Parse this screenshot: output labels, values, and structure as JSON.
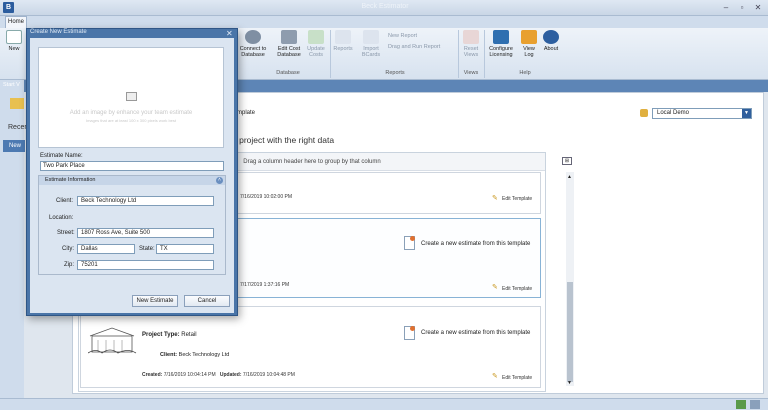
{
  "window": {
    "title": "Beck Estimator"
  },
  "ribbon": {
    "tabs": [
      "Home"
    ],
    "buttons": {
      "new": "New",
      "connect": "Connect to Database",
      "edit_cost": "Edit Cost Database",
      "update_costs": "Update Costs",
      "reports": "Reports",
      "import_bcards": "Import BCards",
      "new_report": "New Report",
      "drag_report": "Drag and Run Report",
      "reset_views": "Reset Views",
      "configure": "Configure Licensing",
      "view_log": "View Log",
      "about": "About"
    },
    "groups": {
      "database": "Database",
      "reports": "Reports",
      "views": "Views",
      "help": "Help"
    }
  },
  "left": {
    "start": "Start V",
    "recent": "Recen",
    "new": "New"
  },
  "main": {
    "template_label": "template",
    "section_title": "e project with the right data",
    "database": "Local Demo",
    "group_header": "Drag a column header here to group by that column"
  },
  "cards": [
    {
      "created": "7/16/2019 10:02:00 PM",
      "edit": "Edit Template"
    },
    {
      "created": "7/17/2019 1:37:16 PM",
      "edit": "Edit Template",
      "new_from": "Create a new estimate from this template"
    },
    {
      "project_type_label": "Project Type:",
      "project_type": "Retail",
      "client_label": "Client:",
      "client": "Beck Technology Ltd",
      "created_label": "Created:",
      "created": "7/16/2019 10:04:14 PM",
      "updated_label": "Updated:",
      "updated": "7/16/2019 10:04:48 PM",
      "edit": "Edit Template",
      "new_from": "Create a new estimate from this template"
    }
  ],
  "dialog": {
    "title": "Create New Estimate",
    "image_placeholder": "Add an image by enhance your team estimate",
    "image_sub": "Images that are at least 100 x 300 pixels work best",
    "name_label": "Estimate Name:",
    "name_value": "Two Park Place",
    "info_header": "Estimate Information",
    "client_label": "Client:",
    "client_value": "Beck Technology Ltd",
    "location_label": "Location:",
    "street_label": "Street:",
    "street_value": "1807 Ross Ave, Suite 500",
    "city_label": "City:",
    "city_value": "Dallas",
    "state_label": "State:",
    "state_value": "TX",
    "zip_label": "Zip:",
    "zip_value": "75201",
    "ok_label": "New Estimate",
    "cancel_label": "Cancel"
  },
  "icons": [
    "app-icon",
    "new-icon",
    "database-icon",
    "cost-db-icon",
    "update-icon",
    "reports-icon",
    "import-icon",
    "reset-views-icon",
    "licensing-icon",
    "log-icon",
    "about-icon",
    "image-icon",
    "pencil-icon",
    "document-icon",
    "close-icon",
    "collapse-icon"
  ]
}
